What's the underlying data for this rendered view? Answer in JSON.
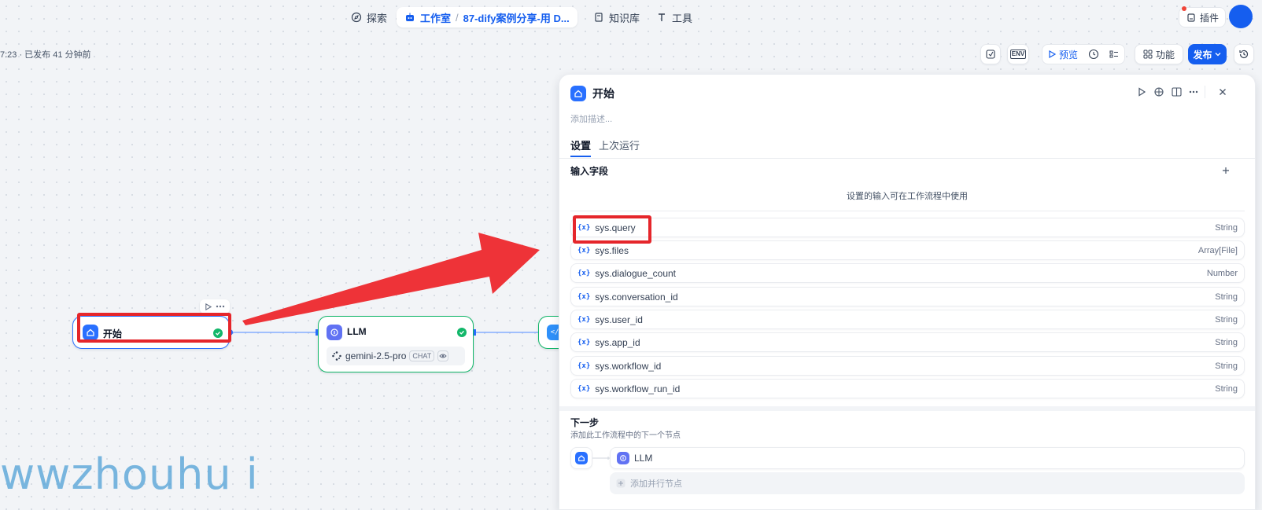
{
  "nav": {
    "explore": "探索",
    "studio": "工作室",
    "app_name": "87-dify案例分享-用 D...",
    "knowledge": "知识库",
    "tools": "工具",
    "plugins": "插件"
  },
  "status": "7:23 · 已发布 41 分钟前",
  "toolbar": {
    "env": "ENV",
    "preview": "预览",
    "features": "功能",
    "publish": "发布"
  },
  "canvas": {
    "start_node": "开始",
    "llm_node": "LLM",
    "model": "gemini-2.5-pro",
    "model_badge": "CHAT",
    "next_node_partial": "</"
  },
  "panel": {
    "title": "开始",
    "desc_placeholder": "添加描述...",
    "tabs": [
      "设置",
      "上次运行"
    ],
    "input_fields_label": "输入字段",
    "hint": "设置的输入可在工作流程中使用",
    "var_icon": "{x}",
    "variables": [
      {
        "name": "sys.query",
        "type": "String"
      },
      {
        "name": "sys.files",
        "type": "Array[File]"
      },
      {
        "name": "sys.dialogue_count",
        "type": "Number"
      },
      {
        "name": "sys.conversation_id",
        "type": "String"
      },
      {
        "name": "sys.user_id",
        "type": "String"
      },
      {
        "name": "sys.app_id",
        "type": "String"
      },
      {
        "name": "sys.workflow_id",
        "type": "String"
      },
      {
        "name": "sys.workflow_run_id",
        "type": "String"
      }
    ],
    "next_step_label": "下一步",
    "next_step_sub": "添加此工作流程中的下一个节点",
    "next_node": "LLM",
    "add_parallel": "添加并行节点"
  },
  "watermark": "wwzhouhu i",
  "colors": {
    "primary": "#155eef",
    "success": "#12b76a",
    "annotation_red": "#e5262b",
    "watermark": "#4fa0d5"
  }
}
